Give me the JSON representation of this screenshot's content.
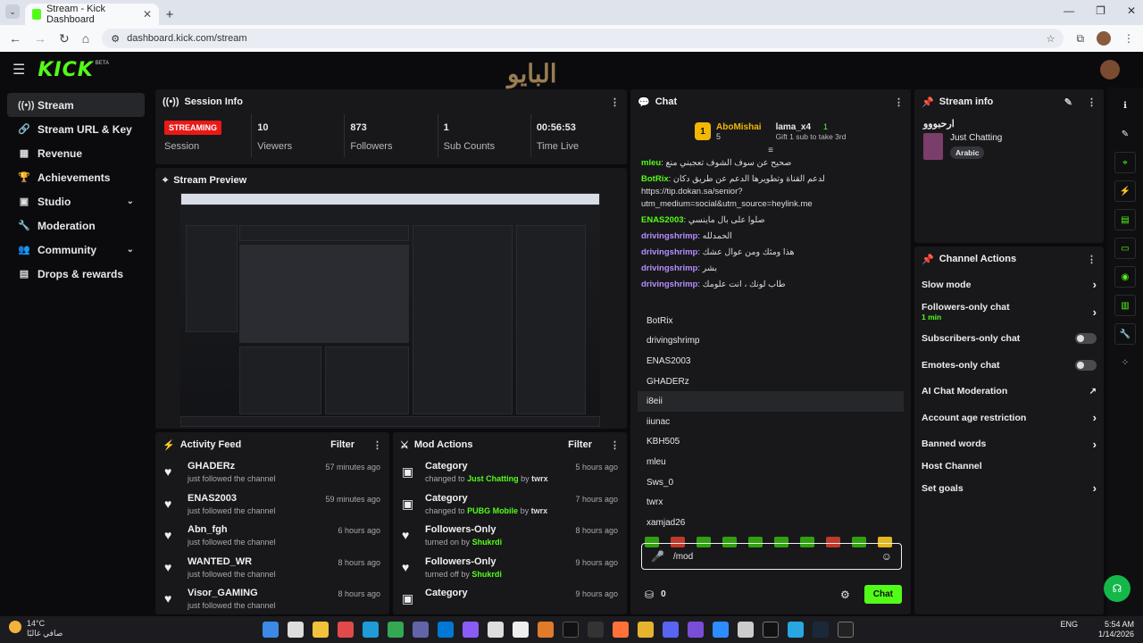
{
  "browser": {
    "tab_title": "Stream - Kick Dashboard",
    "url": "dashboard.kick.com/stream"
  },
  "nav": {
    "logo": "KICK",
    "beta": "BETA",
    "watermark": "البايو"
  },
  "sidebar": {
    "items": [
      {
        "label": "Stream",
        "icon": "broadcast-icon"
      },
      {
        "label": "Stream URL & Key",
        "icon": "link-icon"
      },
      {
        "label": "Revenue",
        "icon": "chart-icon"
      },
      {
        "label": "Achievements",
        "icon": "trophy-icon"
      },
      {
        "label": "Studio",
        "icon": "studio-icon"
      },
      {
        "label": "Moderation",
        "icon": "wrench-icon"
      },
      {
        "label": "Community",
        "icon": "community-icon"
      },
      {
        "label": "Drops & rewards",
        "icon": "drops-icon"
      }
    ]
  },
  "session": {
    "title": "Session Info",
    "badge": "STREAMING",
    "session_label": "Session",
    "stats": [
      {
        "value": "10",
        "label": "Viewers"
      },
      {
        "value": "873",
        "label": "Followers"
      },
      {
        "value": "1",
        "label": "Sub Counts"
      },
      {
        "value": "00:56:53",
        "label": "Time Live"
      }
    ]
  },
  "preview": {
    "title": "Stream Preview"
  },
  "activity": {
    "title": "Activity Feed",
    "filter": "Filter",
    "items": [
      {
        "name": "GHADERz",
        "sub": "just followed the channel",
        "time": "57 minutes ago"
      },
      {
        "name": "ENAS2003",
        "sub": "just followed the channel",
        "time": "59 minutes ago"
      },
      {
        "name": "Abn_fgh",
        "sub": "just followed the channel",
        "time": "6 hours ago"
      },
      {
        "name": "WANTED_WR",
        "sub": "just followed the channel",
        "time": "8 hours ago"
      },
      {
        "name": "Visor_GAMING",
        "sub": "just followed the channel",
        "time": "8 hours ago"
      }
    ]
  },
  "mod": {
    "title": "Mod Actions",
    "filter": "Filter",
    "items": [
      {
        "name": "Category",
        "pre": "changed to",
        "hl": "Just Chatting",
        "by": "by",
        "user": "twrx",
        "time": "5 hours ago"
      },
      {
        "name": "Category",
        "pre": "changed to",
        "hl": "PUBG Mobile",
        "by": "by",
        "user": "twrx",
        "time": "7 hours ago"
      },
      {
        "name": "Followers-Only",
        "pre": "turned on by",
        "hl": "",
        "by": "",
        "user": "Shukrdi",
        "time": "8 hours ago"
      },
      {
        "name": "Followers-Only",
        "pre": "turned off by",
        "hl": "",
        "by": "",
        "user": "Shukrdi",
        "time": "9 hours ago"
      },
      {
        "name": "Category",
        "pre": "",
        "hl": "",
        "by": "",
        "user": "",
        "time": "9 hours ago"
      }
    ]
  },
  "chat": {
    "title": "Chat",
    "top": {
      "rank": "1",
      "name1": "AboMishai",
      "count1": "5",
      "name2": "lama_x4",
      "count2": "1",
      "gift": "Gift 1 sub to take 3rd"
    },
    "messages": [
      {
        "user": "mleu",
        "text": "صحيح عن سوف الشوف تعجبني منع",
        "color": "#53fc18"
      },
      {
        "user": "BotRix",
        "text": "لدعم القناة وتطويرها الدعم عن طريق دكان https://tip.dokan.sa/senior?utm_medium=social&utm_source=heylink.me",
        "color": "#53fc18"
      },
      {
        "user": "ENAS2003",
        "text": "صلوا على بال ماينسي",
        "color": "#53fc18"
      },
      {
        "user": "drivingshrimp",
        "text": "الحمدلله",
        "color": "#b58cff"
      },
      {
        "user": "drivingshrimp",
        "text": "هذا ومثك ومن عوال عشك",
        "color": "#b58cff"
      },
      {
        "user": "drivingshrimp",
        "text": "بشر",
        "color": "#b58cff"
      },
      {
        "user": "drivingshrimp",
        "text": "طاب لونك ، انت علومك",
        "color": "#b58cff"
      }
    ],
    "suggestions": [
      "BotRix",
      "drivingshrimp",
      "ENAS2003",
      "GHADERz",
      "i8eii",
      "iiunac",
      "KBH505",
      "mleu",
      "Sws_0",
      "twrx",
      "xamjad26"
    ],
    "input_value": "/mod",
    "points": "0",
    "send": "Chat"
  },
  "streaminfo": {
    "title": "Stream info",
    "stream_title": "ارحبووو",
    "category": "Just Chatting",
    "tag": "Arabic"
  },
  "channel_actions": {
    "title": "Channel Actions",
    "items": [
      {
        "label": "Slow mode",
        "kind": "arrow",
        "sub": ""
      },
      {
        "label": "Followers-only chat",
        "kind": "arrow",
        "sub": "1 min"
      },
      {
        "label": "Subscribers-only chat",
        "kind": "toggle",
        "sub": ""
      },
      {
        "label": "Emotes-only chat",
        "kind": "toggle",
        "sub": ""
      },
      {
        "label": "AI Chat Moderation",
        "kind": "ext",
        "sub": ""
      },
      {
        "label": "Account age restriction",
        "kind": "arrow",
        "sub": ""
      },
      {
        "label": "Banned words",
        "kind": "arrow",
        "sub": ""
      },
      {
        "label": "Host Channel",
        "kind": "none",
        "sub": ""
      },
      {
        "label": "Set goals",
        "kind": "arrow",
        "sub": ""
      }
    ]
  },
  "taskbar": {
    "temp": "14°C",
    "weather": "صافي غالبًا",
    "time": "5:54 AM",
    "date": "1/14/2026",
    "lang": "ENG"
  }
}
